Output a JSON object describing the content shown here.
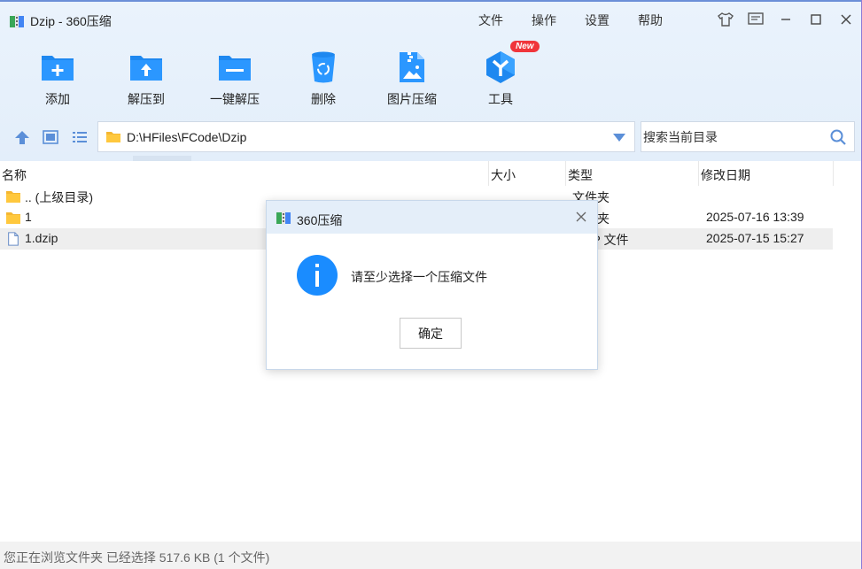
{
  "window": {
    "title": "Dzip - 360压缩"
  },
  "menu": [
    "文件",
    "操作",
    "设置",
    "帮助"
  ],
  "toolbar": [
    {
      "label": "添加",
      "icon": "add-folder-icon"
    },
    {
      "label": "解压到",
      "icon": "extract-to-icon"
    },
    {
      "label": "一键解压",
      "icon": "one-click-extract-icon"
    },
    {
      "label": "删除",
      "icon": "recycle-bin-icon"
    },
    {
      "label": "图片压缩",
      "icon": "image-compress-icon"
    },
    {
      "label": "工具",
      "icon": "tools-icon",
      "badge": "New"
    }
  ],
  "nav": {
    "path": "D:\\HFiles\\FCode\\Dzip",
    "search_placeholder": "搜索当前目录"
  },
  "columns": {
    "name": "名称",
    "size": "大小",
    "type": "类型",
    "modified": "修改日期"
  },
  "files": [
    {
      "name": ".. (上级目录)",
      "type": "文件夹",
      "modified": "",
      "icon": "folder-icon"
    },
    {
      "name": "1",
      "type": "文件夹",
      "modified": "2025-07-16 13:39",
      "icon": "folder-icon"
    },
    {
      "name": "1.dzip",
      "type": "DZIP 文件",
      "modified": "2025-07-15 15:27",
      "icon": "file-icon"
    }
  ],
  "status": "您正在浏览文件夹 已经选择 517.6 KB (1 个文件)",
  "dialog": {
    "title": "360压缩",
    "message": "请至少选择一个压缩文件",
    "ok_label": "确定"
  },
  "colors": {
    "accent": "#1a8cff",
    "titlebar": "#e3eefa"
  }
}
